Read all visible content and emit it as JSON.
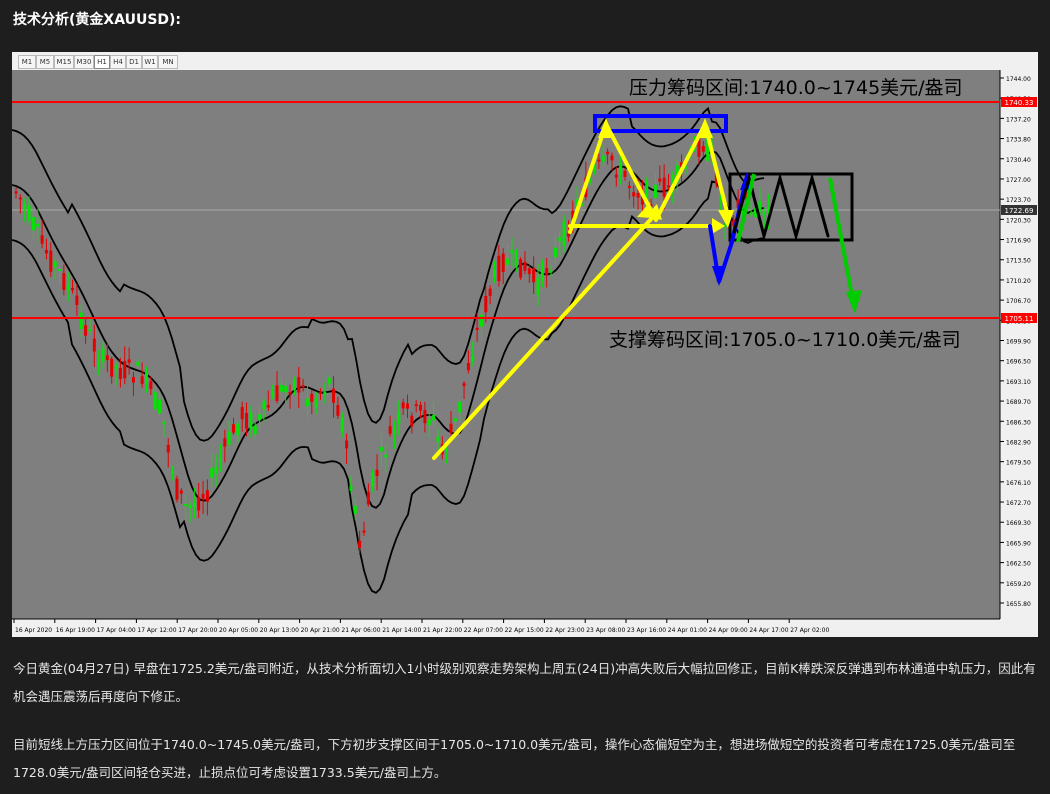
{
  "title": "技术分析(黄金XAUUSD):",
  "timeframes": [
    "M1",
    "M5",
    "M15",
    "M30",
    "H1",
    "H4",
    "D1",
    "W1",
    "MN"
  ],
  "active_timeframe": "H1",
  "chart": {
    "resistance_label": "压力筹码区间:1740.0~1745美元/盎司",
    "support_label": "支撑筹码区间:1705.0~1710.0美元/盎司",
    "resistance_price_tag": "1740.33",
    "current_price_tag": "1722.69",
    "support_price_tag": "1705.11",
    "y_ticks": [
      "1744.00",
      "1740.50",
      "1737.20",
      "1733.80",
      "1730.40",
      "1727.00",
      "1723.70",
      "1720.30",
      "1716.90",
      "1713.50",
      "1710.20",
      "1706.70",
      "1703.30",
      "1699.90",
      "1696.50",
      "1693.10",
      "1689.70",
      "1686.30",
      "1682.90",
      "1679.50",
      "1676.10",
      "1672.70",
      "1669.30",
      "1665.90",
      "1662.50",
      "1659.20",
      "1655.80"
    ],
    "x_ticks": [
      "16 Apr 2020",
      "16 Apr 19:00",
      "17 Apr 04:00",
      "17 Apr 12:00",
      "17 Apr 20:00",
      "20 Apr 05:00",
      "20 Apr 13:00",
      "20 Apr 21:00",
      "21 Apr 06:00",
      "21 Apr 14:00",
      "21 Apr 22:00",
      "22 Apr 07:00",
      "22 Apr 15:00",
      "22 Apr 23:00",
      "23 Apr 08:00",
      "23 Apr 16:00",
      "24 Apr 01:00",
      "24 Apr 09:00",
      "24 Apr 17:00",
      "27 Apr 02:00"
    ],
    "colors": {
      "background": "#7f7f7f",
      "bull": "#00e600",
      "bear": "#e60000",
      "resistance": "#ff0000",
      "arrow": "#ffff00",
      "band": "#000000",
      "box_blue": "#0000ff",
      "arrow_down": "#00cc00"
    }
  },
  "paragraphs": {
    "p1": "今日黄金(04月27日) 早盘在1725.2美元/盎司附近，从技术分析面切入1小时级别观察走势架构上周五(24日)冲高失败后大幅拉回修正，目前K棒跌深反弹遇到布林通道中轨压力，因此有机会遇压震荡后再度向下修正。",
    "p2": "目前短线上方压力区间位于1740.0~1745.0美元/盎司，下方初步支撑区间于1705.0~1710.0美元/盎司，操作心态偏短空为主，想进场做短空的投资者可考虑在1725.0美元/盎司至1728.0美元/盎司区间轻仓买进，止损点位可考虑设置1733.5美元/盎司上方。"
  }
}
